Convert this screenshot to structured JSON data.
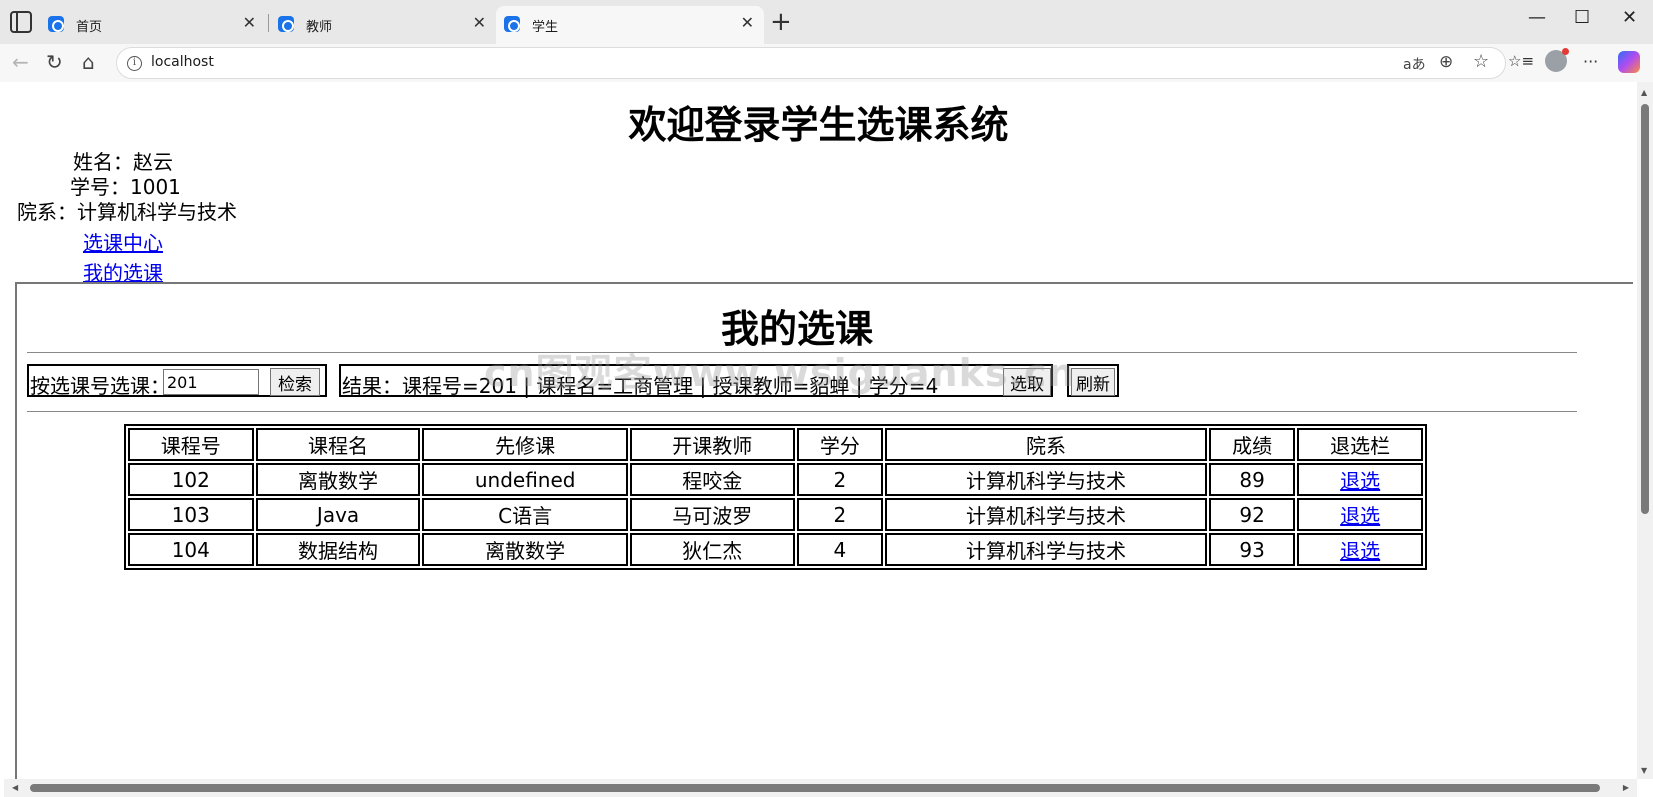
{
  "browser": {
    "tabs": [
      {
        "title": "首页",
        "active": false
      },
      {
        "title": "教师",
        "active": false
      },
      {
        "title": "学生",
        "active": true
      }
    ],
    "url": "localhost",
    "icons": {
      "back": "←",
      "refresh": "↻",
      "home": "⌂",
      "new_tab": "+",
      "minimize": "—",
      "maximize": "☐",
      "close": "✕",
      "tab_close": "✕",
      "read_aloud": "aあ",
      "zoom": "⊕",
      "favorite": "☆",
      "favorites": "☆≡",
      "more": "···"
    }
  },
  "page": {
    "title": "欢迎登录学生选课系统",
    "student": {
      "name_line": "姓名：赵云",
      "id_line": "学号：1001",
      "dept_line": "院系：计算机科学与技术"
    },
    "nav": [
      "选课中心",
      "我的选课"
    ],
    "section_title": "我的选课",
    "search": {
      "label": "按选课号选课：",
      "value": "201",
      "button": "检索"
    },
    "result": {
      "text": "结果：课程号=201 | 课程名=工商管理 | 授课教师=貂蝉 | 学分=4",
      "select_button": "选取",
      "refresh_button": "刷新"
    },
    "table": {
      "headers": [
        "课程号",
        "课程名",
        "先修课",
        "开课教师",
        "学分",
        "院系",
        "成绩",
        "退选栏"
      ],
      "rows": [
        [
          "102",
          "离散数学",
          "undefined",
          "程咬金",
          "2",
          "计算机科学与技术",
          "89",
          "退选"
        ],
        [
          "103",
          "Java",
          "C语言",
          "马可波罗",
          "2",
          "计算机科学与技术",
          "92",
          "退选"
        ],
        [
          "104",
          "数据结构",
          "离散数学",
          "狄仁杰",
          "4",
          "计算机科学与技术",
          "93",
          "退选"
        ]
      ]
    },
    "watermark": "cn图观客www.wsiguanks.cn"
  }
}
